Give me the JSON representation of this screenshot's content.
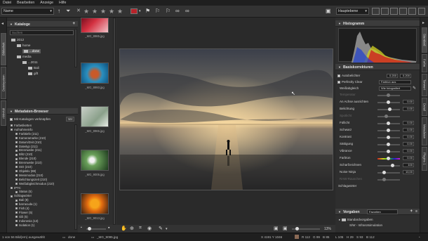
{
  "menu": [
    "Datei",
    "Bearbeiten",
    "Anzeige",
    "Hilfe"
  ],
  "toolbar": {
    "sort_value": "Name",
    "layout_value": "Hauptebene",
    "color_label": "red"
  },
  "left_tabs": [
    "Bibliothek",
    "Dateisystem",
    "Aktivität"
  ],
  "catalogs": {
    "title": "Kataloge",
    "search_placeholder": "Suchen",
    "tree": [
      {
        "label": "2012",
        "indent": 0
      },
      {
        "label": "home",
        "indent": 1
      },
      {
        "label": "...done",
        "indent": 2,
        "selected": true
      },
      {
        "label": "media",
        "indent": 1
      },
      {
        "label": "...2011",
        "indent": 2
      },
      {
        "label": "Bali",
        "indent": 3
      },
      {
        "label": "gift",
        "indent": 3
      }
    ]
  },
  "metadata": {
    "title": "Metadaten-Browser",
    "all_catalogs": "Mit Katalogen verknüpfen",
    "all_button": "Ver",
    "items": [
      {
        "label": "Farbetiketten",
        "indent": 0
      },
      {
        "label": "Aufnahmeinfo",
        "indent": 0
      },
      {
        "label": "Farbtiefe (211)",
        "indent": 1
      },
      {
        "label": "Kameramarke (210)",
        "indent": 1
      },
      {
        "label": "Datum/Zeit (210)",
        "indent": 1
      },
      {
        "label": "Dateityp (211)",
        "indent": 1
      },
      {
        "label": "Brennweite (211)",
        "indent": 1
      },
      {
        "label": "Blitz (210)",
        "indent": 1
      },
      {
        "label": "Blende (210)",
        "indent": 1
      },
      {
        "label": "Brennweite (210)",
        "indent": 1
      },
      {
        "label": "ISO (210)",
        "indent": 1
      },
      {
        "label": "Objektiv (88)",
        "indent": 1
      },
      {
        "label": "Messmodus (210)",
        "indent": 1
      },
      {
        "label": "Belichtungszeit (210)",
        "indent": 1
      },
      {
        "label": "Weißabgleichmodus (210)",
        "indent": 1
      },
      {
        "label": "IPTC",
        "indent": 0
      },
      {
        "label": "Status (6)",
        "indent": 1
      },
      {
        "label": "Schlagwörter",
        "indent": 0
      },
      {
        "label": "Bali (8)",
        "indent": 1
      },
      {
        "label": "barracuda (1)",
        "indent": 1
      },
      {
        "label": "Fish (4)",
        "indent": 1
      },
      {
        "label": "Flower (5)",
        "indent": 1
      },
      {
        "label": "Gili (5)",
        "indent": 1
      },
      {
        "label": "Indonesia (13)",
        "indent": 1
      },
      {
        "label": "Isolation (1)",
        "indent": 1
      }
    ]
  },
  "filmstrip": [
    {
      "name": "_MG_8985.jpg"
    },
    {
      "name": "_MG_8993.jpg"
    },
    {
      "name": "_MG_8965.jpg"
    },
    {
      "name": "_MG_9005.jpg"
    },
    {
      "name": "_MG_9013.jpg"
    }
  ],
  "histogram": {
    "title": "Histogramm"
  },
  "basic": {
    "title": "Basiskorrekturen",
    "autoexposure": "Autobelichter",
    "auto_val1": "0.200",
    "auto_val2": "0.200",
    "perfectly_clear": "Perfectly Clear",
    "pc_value": "Farbton aus",
    "white_balance": "Weißabgleich",
    "wb_value": "Wie fotografiert",
    "sliders": [
      {
        "label": "Temperatur",
        "value": "",
        "pos": 0.5,
        "dim": true
      },
      {
        "label": "An Achse ausrichten",
        "value": "0.00",
        "pos": 0.5
      },
      {
        "label": "Belichtung",
        "value": "0.00",
        "pos": 0.55
      },
      {
        "label": "Spotlicht",
        "value": "",
        "pos": 0.4,
        "dim": true
      },
      {
        "label": "Füllicht",
        "value": "0.00",
        "pos": 0.5
      },
      {
        "label": "Schwarz",
        "value": "0.00",
        "pos": 0.5
      },
      {
        "label": "Kontrast",
        "value": "0.00",
        "pos": 0.5
      },
      {
        "label": "Sättigung",
        "value": "0.00",
        "pos": 0.5
      },
      {
        "label": "Vibrance",
        "value": "0.00",
        "pos": 0.5
      },
      {
        "label": "Farbton",
        "value": "0.00",
        "pos": 0.5
      },
      {
        "label": "Scharfzeichnen",
        "value": "100",
        "pos": 0.7
      },
      {
        "label": "Noise Ninja",
        "value": "10,00",
        "pos": 0.3
      },
      {
        "label": "RAW-Rauschen",
        "value": "",
        "pos": 0.3,
        "dim": true
      }
    ],
    "schlagworter": "Schlagwörter"
  },
  "presets": {
    "title": "Vorgaben",
    "dropdown": "Favoriten",
    "items": [
      "Standardvorgaben",
      "S/W - Infrarotsimulation"
    ]
  },
  "right_tabs": [
    "Standard",
    "Farbe",
    "Tonwert",
    "Detail",
    "Metadaten",
    "Plugins 1"
  ],
  "viewer": {
    "zoom": "13%"
  },
  "status": {
    "left": "1 von 56 Bild(ern) ausgewählt",
    "folder": "done",
    "file": "_MG_9095.jpg",
    "coords": "X 4191  Y 1046",
    "r": "R 112",
    "g": "G 99",
    "b": "B 85",
    "l": "L 105",
    "h": "H 29",
    "s": "S 93",
    "bv": "B 112"
  },
  "colors": {
    "accent": "#b8232a",
    "panel": "#2e2e2e",
    "header": "#3c3c3c"
  }
}
